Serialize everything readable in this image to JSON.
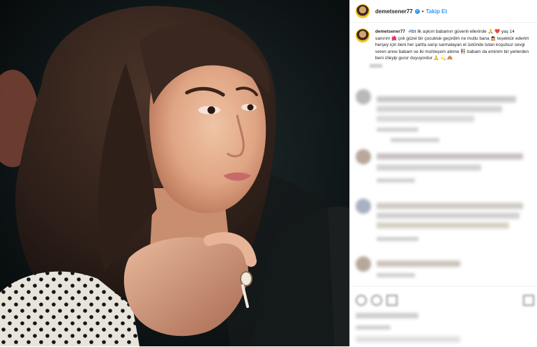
{
  "post": {
    "username": "demetsener77",
    "follow_label": "Takip Et",
    "caption": {
      "username": "demetsener77",
      "hashtag": "#tbt",
      "text": "ilk aşkım babamın güvenli ellerinde 🙏 ❤️ yaş 14 sanırım 🌺 çok güzel bir çocukluk geçirdim ne mutlu bana 🙇🏻 teşekkür ederim herşey için beni her şartta sarıp sarmalayan el üstünde tutan koşulsuz sevgi veren anne babam ve iki muhteşem abime 👫 babam da eminim bir yerlerden beni izleyip gurur duyuyordur 🙏 💫 🙈"
    }
  },
  "colors": {
    "link": "#3897f0",
    "hashtag": "#00376b",
    "text": "#262626",
    "avatar_ring": "#f5c518"
  }
}
